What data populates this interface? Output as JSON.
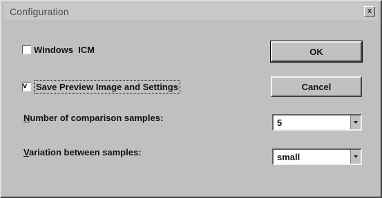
{
  "window": {
    "title": "Configuration",
    "close_glyph": "x"
  },
  "options": {
    "windows_icm": {
      "label": "Windows  ICM",
      "checked": false
    },
    "save_preview": {
      "label": "Save Preview Image and Settings",
      "checked": true,
      "check_glyph": "v"
    }
  },
  "buttons": {
    "ok": "OK",
    "cancel": "Cancel"
  },
  "fields": {
    "comparison_samples": {
      "label_accel": "N",
      "label_rest": "umber of comparison samples:",
      "value": "5"
    },
    "variation": {
      "label_accel": "V",
      "label_rest": "ariation between samples:",
      "value": "small"
    }
  },
  "icons": {
    "close": "close-icon",
    "dropdown": "chevron-down-icon"
  }
}
